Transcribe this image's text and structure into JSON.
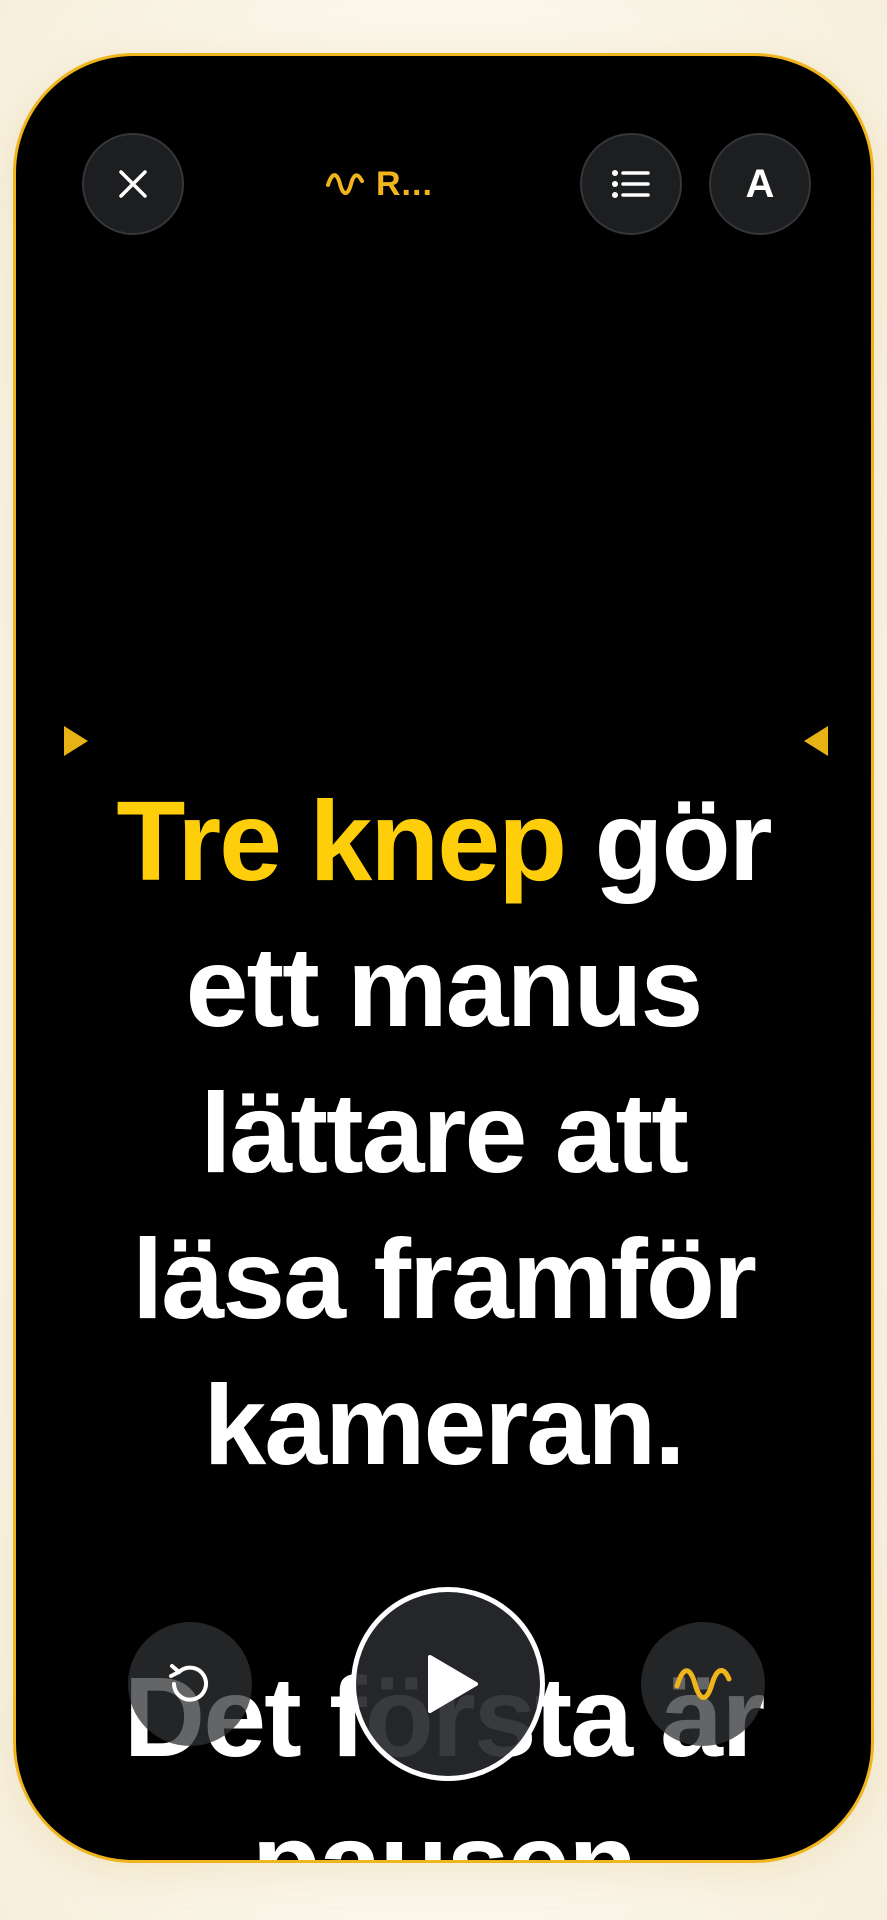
{
  "header": {
    "title": "R...",
    "close_icon": "close-icon",
    "list_icon": "list-icon",
    "font_button_label": "A"
  },
  "script": {
    "highlighted_text": "Tre knep",
    "line1_rest": " gör",
    "line2": "ett manus",
    "line3": "lättare att",
    "line4": "läsa framför",
    "line5": "kameran.",
    "line6": "Det första är",
    "line7": "pausen"
  },
  "controls": {
    "restart_icon": "restart-icon",
    "play_icon": "play-icon",
    "waveform_icon": "waveform-icon"
  },
  "colors": {
    "accent": "#f0b41c",
    "highlight": "#ffce0b",
    "background": "#000000",
    "text": "#ffffff",
    "button_bg": "#1d1e20"
  }
}
